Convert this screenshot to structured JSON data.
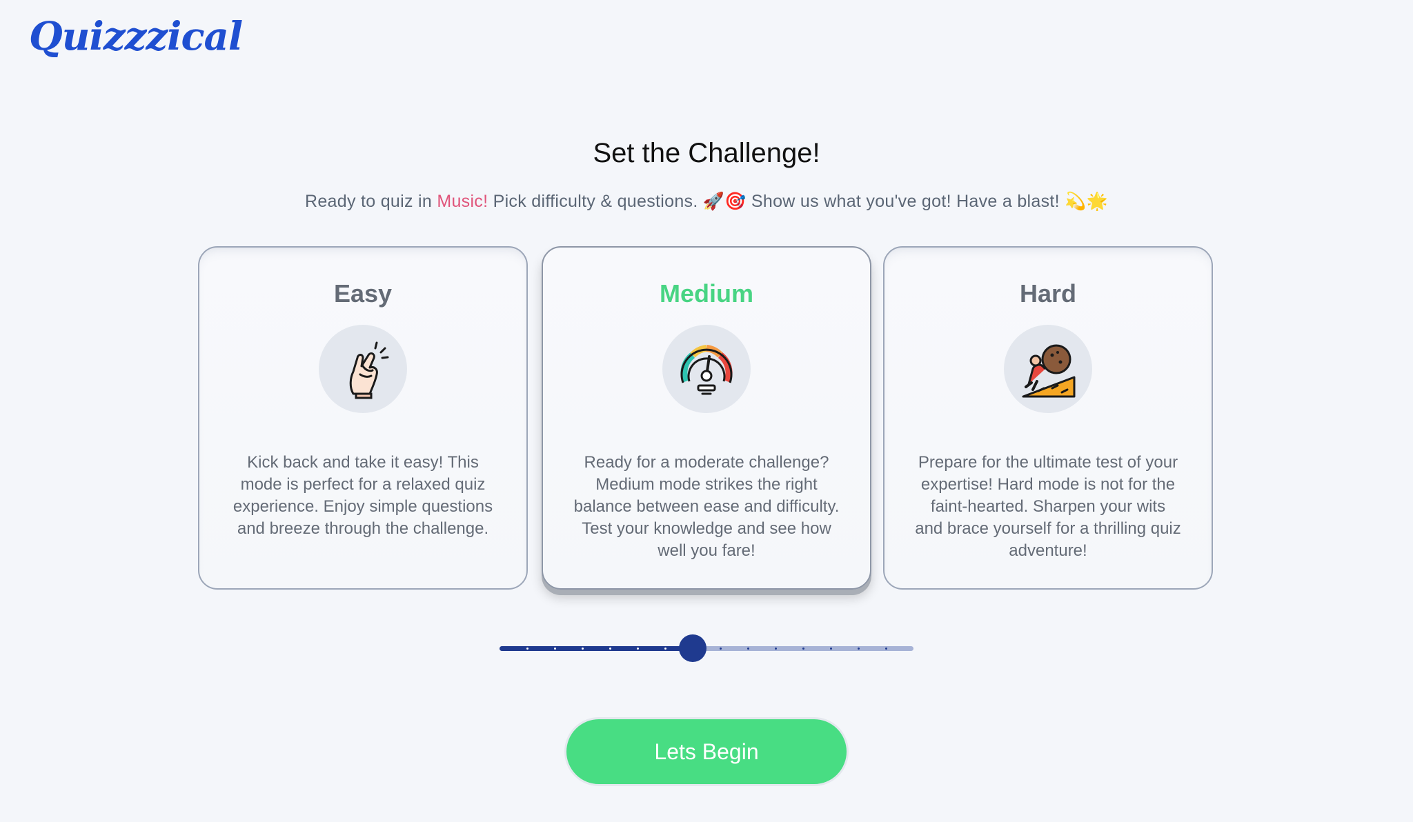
{
  "app": {
    "logo": "Quizzzical"
  },
  "page": {
    "heading": "Set the Challenge!",
    "subtitle_prefix": "Ready to quiz in ",
    "category": "Music",
    "subtitle_bang": "!",
    "subtitle_suffix": " Pick difficulty & questions. 🚀🎯 Show us what you've got! Have a blast! 💫🌟"
  },
  "difficulty": {
    "selected": "Medium",
    "options": [
      {
        "title": "Easy",
        "icon": "snapping-fingers-icon",
        "description": "Kick back and take it easy! This mode is perfect for a relaxed quiz experience. Enjoy simple questions and breeze through the challenge."
      },
      {
        "title": "Medium",
        "icon": "speedometer-icon",
        "description": "Ready for a moderate challenge? Medium mode strikes the right balance between ease and difficulty. Test your knowledge and see how well you fare!"
      },
      {
        "title": "Hard",
        "icon": "pushing-boulder-uphill-icon",
        "description": "Prepare for the ultimate test of your expertise! Hard mode is not for the faint-hearted. Sharpen your wits and brace yourself for a thrilling quiz adventure!"
      }
    ]
  },
  "question_slider": {
    "steps": 15,
    "selected_step": 7,
    "filled_color": "#1f3a8f",
    "empty_color": "#a7b3d6"
  },
  "start_button": {
    "label": "Lets Begin",
    "color": "#48dd83"
  },
  "colors": {
    "logo": "#1f4fd1",
    "selected_title": "#48d483",
    "category_highlight": "#e0557b"
  }
}
